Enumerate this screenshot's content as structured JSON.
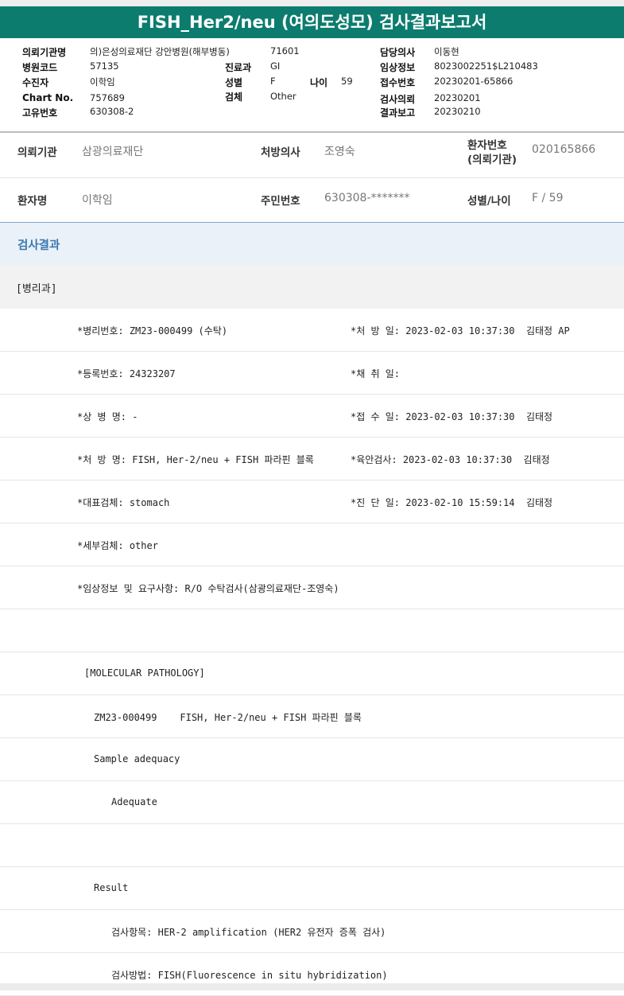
{
  "title": "FISH_Her2/neu (여의도성모) 검사결과보고서",
  "header": {
    "req_inst_label": "의뢰기관명",
    "req_inst_value": "의)은성의료재단 강안병원(해부병동)",
    "req_inst_code": "71601",
    "hosp_code_label": "병원코드",
    "hosp_code_value": "57135",
    "patient_label": "수진자",
    "patient_value": "이학임",
    "chart_label": "Chart No.",
    "chart_value": "757689",
    "unique_label": "고유번호",
    "unique_value": "630308-2",
    "dept_label": "진료과",
    "dept_value": "GI",
    "sex_label": "성별",
    "sex_value": "F",
    "age_label": "나이",
    "age_value": "59",
    "specimen_label": "검체",
    "specimen_value": "Other",
    "doctor_label": "담당의사",
    "doctor_value": "이동현",
    "clinical_label": "임상정보",
    "clinical_value": "8023002251$L210483",
    "receipt_label": "접수번호",
    "receipt_value": "20230201-65866",
    "request_label": "검사의뢰",
    "request_value": "20230201",
    "report_label": "결과보고",
    "report_value": "20230210"
  },
  "info": {
    "req_inst_label": "의뢰기관",
    "req_inst_value": "삼광의료재단",
    "presc_label": "처방의사",
    "presc_value": "조영숙",
    "pno_label_1": "환자번호",
    "pno_label_2": "(의뢰기관)",
    "pno_value": "020165866",
    "pname_label": "환자명",
    "pname_value": "이학임",
    "rrn_label": "주민번호",
    "rrn_value": "630308-*******",
    "sexage_label": "성별/나이",
    "sexage_value": "F / 59"
  },
  "result_title": "검사결과",
  "department": "[병리과]",
  "lines": [
    {
      "left": "*병리번호: ZM23-000499 (수탁)",
      "right": "*처 방 일: 2023-02-03 10:37:30  김태정 AP"
    },
    {
      "left": "*등록번호: 24323207",
      "right": "*채 취 일:"
    },
    {
      "left": "*상 병 명: -",
      "right": "*접 수 일: 2023-02-03 10:37:30  김태정"
    },
    {
      "left": "*처 방 명: FISH, Her-2/neu + FISH 파라핀 블록",
      "right": "*육안검사: 2023-02-03 10:37:30  김태정"
    },
    {
      "left": "*대표검체: stomach",
      "right": "*진 단 일: 2023-02-10 15:59:14  김태정"
    },
    {
      "left": "*세부검체: other",
      "right": ""
    },
    {
      "left": "*임상정보 및 요구사항: R/O 수탁검사(삼광의료재단-조영숙)",
      "right": ""
    },
    {
      "left": "",
      "right": ""
    },
    {
      "left": "[MOLECULAR PATHOLOGY]",
      "right": ""
    },
    {
      "left": "ZM23-000499    FISH, Her-2/neu + FISH 파라핀 블록",
      "right": ""
    },
    {
      "left": "Sample adequacy",
      "right": ""
    },
    {
      "left": "Adequate",
      "right": ""
    },
    {
      "left": "",
      "right": ""
    },
    {
      "left": "Result",
      "right": ""
    },
    {
      "left": "검사항목: HER-2 amplification (HER2 유전자 증폭 검사)",
      "right": ""
    },
    {
      "left": "검사방법: FISH(Fluorescence in situ hybridization)",
      "right": ""
    }
  ]
}
